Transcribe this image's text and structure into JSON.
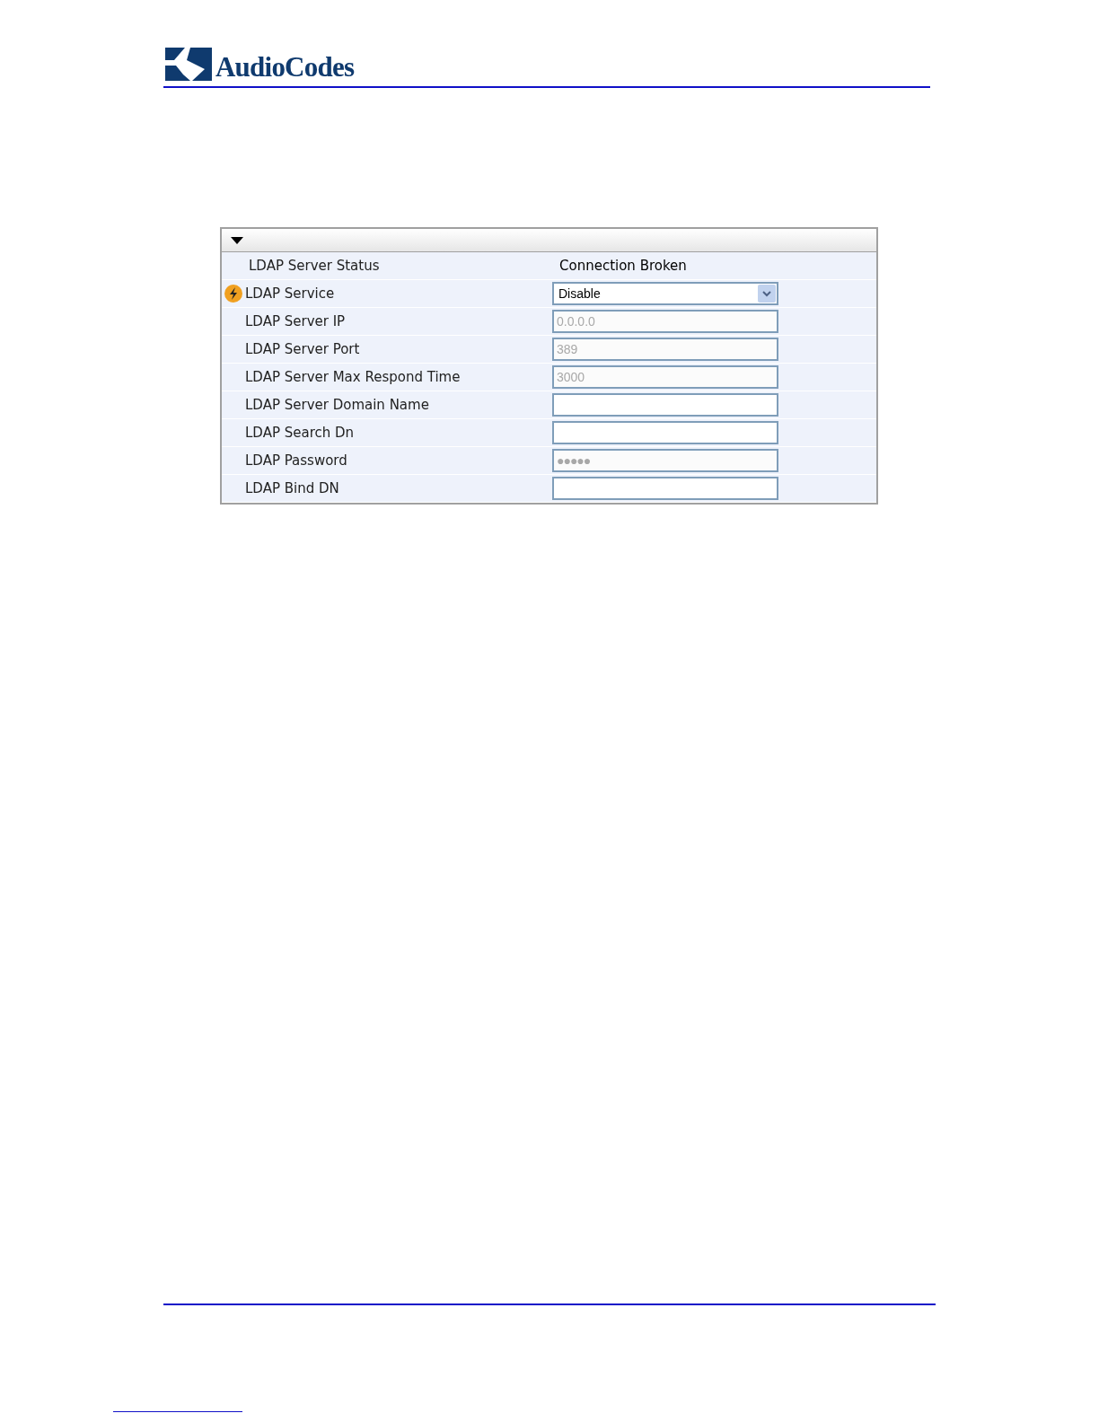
{
  "header": {
    "logo_text": "AudioCodes"
  },
  "panel": {
    "expanded": true,
    "rows": [
      {
        "kind": "status",
        "label": "LDAP Server Status",
        "value": "Connection Broken",
        "changed": false
      },
      {
        "kind": "select",
        "label": "LDAP Service",
        "value": "Disable",
        "changed": true,
        "disabled": false
      },
      {
        "kind": "input",
        "label": "LDAP Server IP",
        "value": "0.0.0.0",
        "changed": false,
        "disabled": true
      },
      {
        "kind": "input",
        "label": "LDAP Server Port",
        "value": "389",
        "changed": false,
        "disabled": true
      },
      {
        "kind": "input",
        "label": "LDAP Server Max Respond Time",
        "value": "3000",
        "changed": false,
        "disabled": true
      },
      {
        "kind": "input",
        "label": "LDAP Server Domain Name",
        "changed": false
      },
      {
        "kind": "input",
        "label": "LDAP Search Dn",
        "changed": false
      },
      {
        "kind": "password",
        "label": "LDAP Password",
        "value": "●●●●●",
        "changed": false,
        "disabled": true
      },
      {
        "kind": "input",
        "label": "LDAP Bind DN",
        "changed": false
      }
    ]
  }
}
